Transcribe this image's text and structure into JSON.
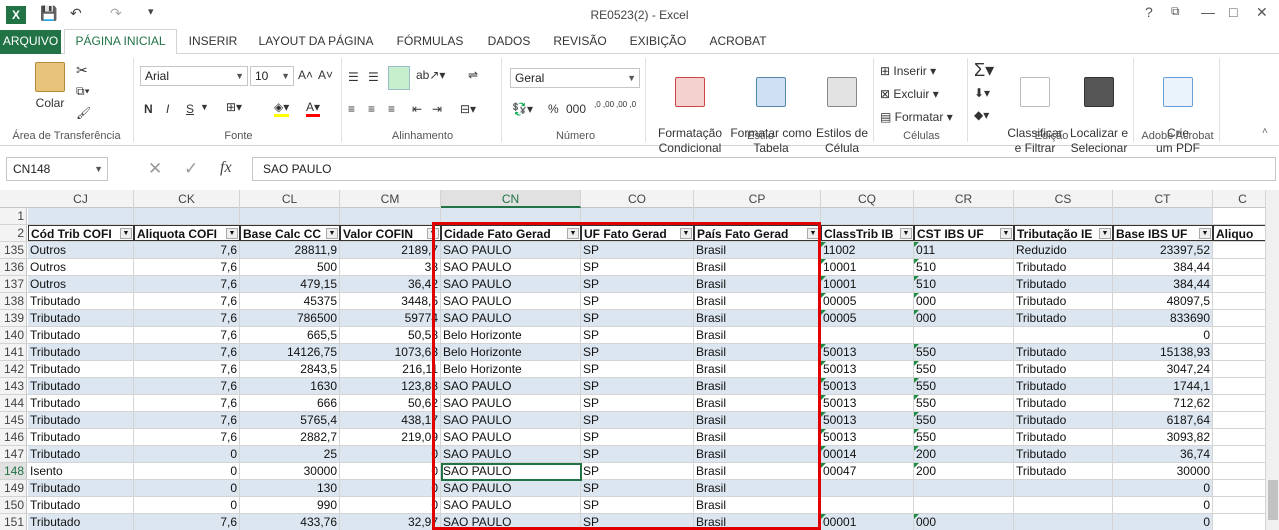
{
  "window": {
    "title": "RE0523(2) - Excel",
    "help": "?",
    "restore": "⧉",
    "min": "—",
    "max": "□",
    "close": "✕"
  },
  "quick_access": {
    "app_icon": "X",
    "save": "💾",
    "undo": "↶",
    "redo": "↷",
    "more": "▾"
  },
  "tabs": [
    "ARQUIVO",
    "PÁGINA INICIAL",
    "INSERIR",
    "LAYOUT DA PÁGINA",
    "FÓRMULAS",
    "DADOS",
    "REVISÃO",
    "EXIBIÇÃO",
    "ACROBAT"
  ],
  "active_tab": "PÁGINA INICIAL",
  "ribbon": {
    "clipboard": {
      "paste": "Colar",
      "label": "Área de Transferência"
    },
    "font": {
      "name": "Arial",
      "size": "10",
      "bold": "N",
      "italic": "I",
      "underline": "S",
      "grow": "A˄",
      "shrink": "A˅",
      "label": "Fonte"
    },
    "alignment": {
      "label": "Alinhamento"
    },
    "number": {
      "format": "Geral",
      "percent": "%",
      "thousands": "000",
      "dec_up": ",0 ,00",
      "dec_down": ",00 ,0",
      "label": "Número"
    },
    "styles": {
      "cond_format": "Formatação\nCondicional",
      "format_table": "Formatar como\nTabela",
      "cell_styles": "Estilos de\nCélula",
      "label": "Estilo"
    },
    "cells": {
      "insert": "Inserir",
      "delete": "Excluir",
      "format": "Formatar",
      "label": "Células"
    },
    "editing": {
      "sort": "Classificar\ne Filtrar",
      "find": "Localizar e\nSelecionar",
      "label": "Edição"
    },
    "acrobat": {
      "create_pdf": "Crie\num PDF",
      "label": "Adobe Acrobat"
    }
  },
  "formula_bar": {
    "name_box": "CN148",
    "cancel": "✕",
    "enter": "✓",
    "fx": "fx",
    "value": "SAO PAULO"
  },
  "columns": [
    "CJ",
    "CK",
    "CL",
    "CM",
    "CN",
    "CO",
    "CP",
    "CQ",
    "CR",
    "CS",
    "CT",
    "C"
  ],
  "selected_column": "CN",
  "header_row": [
    "Cód Trib COFI",
    "Aliquota COFI",
    "Base Calc CC",
    "Valor COFIN",
    "Cidade Fato Gerad",
    "UF Fato Gerad",
    "País Fato Gerad",
    "ClassTrib IB",
    "CST IBS UF",
    "Tributação IE",
    "Base IBS UF",
    "Aliquo"
  ],
  "rows": [
    {
      "n": "135",
      "cells": [
        "Outros",
        "7,6",
        "28811,9",
        "2189,7",
        "SAO PAULO",
        "SP",
        "Brasil",
        "11002",
        "011",
        "Reduzido",
        "23397,52"
      ]
    },
    {
      "n": "136",
      "cells": [
        "Outros",
        "7,6",
        "500",
        "38",
        "SAO PAULO",
        "SP",
        "Brasil",
        "10001",
        "510",
        "Tributado",
        "384,44"
      ]
    },
    {
      "n": "137",
      "cells": [
        "Outros",
        "7,6",
        "479,15",
        "36,42",
        "SAO PAULO",
        "SP",
        "Brasil",
        "10001",
        "510",
        "Tributado",
        "384,44"
      ]
    },
    {
      "n": "138",
      "cells": [
        "Tributado",
        "7,6",
        "45375",
        "3448,5",
        "SAO PAULO",
        "SP",
        "Brasil",
        "00005",
        "000",
        "Tributado",
        "48097,5"
      ]
    },
    {
      "n": "139",
      "cells": [
        "Tributado",
        "7,6",
        "786500",
        "59774",
        "SAO PAULO",
        "SP",
        "Brasil",
        "00005",
        "000",
        "Tributado",
        "833690"
      ]
    },
    {
      "n": "140",
      "cells": [
        "Tributado",
        "7,6",
        "665,5",
        "50,58",
        "Belo Horizonte",
        "SP",
        "Brasil",
        "",
        "",
        "",
        "0"
      ]
    },
    {
      "n": "141",
      "cells": [
        "Tributado",
        "7,6",
        "14126,75",
        "1073,63",
        "Belo Horizonte",
        "SP",
        "Brasil",
        "50013",
        "550",
        "Tributado",
        "15138,93"
      ]
    },
    {
      "n": "142",
      "cells": [
        "Tributado",
        "7,6",
        "2843,5",
        "216,11",
        "Belo Horizonte",
        "SP",
        "Brasil",
        "50013",
        "550",
        "Tributado",
        "3047,24"
      ]
    },
    {
      "n": "143",
      "cells": [
        "Tributado",
        "7,6",
        "1630",
        "123,88",
        "SAO PAULO",
        "SP",
        "Brasil",
        "50013",
        "550",
        "Tributado",
        "1744,1"
      ]
    },
    {
      "n": "144",
      "cells": [
        "Tributado",
        "7,6",
        "666",
        "50,62",
        "SAO PAULO",
        "SP",
        "Brasil",
        "50013",
        "550",
        "Tributado",
        "712,62"
      ]
    },
    {
      "n": "145",
      "cells": [
        "Tributado",
        "7,6",
        "5765,4",
        "438,17",
        "SAO PAULO",
        "SP",
        "Brasil",
        "50013",
        "550",
        "Tributado",
        "6187,64"
      ]
    },
    {
      "n": "146",
      "cells": [
        "Tributado",
        "7,6",
        "2882,7",
        "219,09",
        "SAO PAULO",
        "SP",
        "Brasil",
        "50013",
        "550",
        "Tributado",
        "3093,82"
      ]
    },
    {
      "n": "147",
      "cells": [
        "Tributado",
        "0",
        "25",
        "0",
        "SAO PAULO",
        "SP",
        "Brasil",
        "00014",
        "200",
        "Tributado",
        "36,74"
      ]
    },
    {
      "n": "148",
      "cells": [
        "Isento",
        "0",
        "30000",
        "0",
        "SAO PAULO",
        "SP",
        "Brasil",
        "00047",
        "200",
        "Tributado",
        "30000"
      ]
    },
    {
      "n": "149",
      "cells": [
        "Tributado",
        "0",
        "130",
        "0",
        "SAO PAULO",
        "SP",
        "Brasil",
        "",
        "",
        "",
        "0"
      ]
    },
    {
      "n": "150",
      "cells": [
        "Tributado",
        "0",
        "990",
        "0",
        "SAO PAULO",
        "SP",
        "Brasil",
        "",
        "",
        "",
        "0"
      ]
    },
    {
      "n": "151",
      "cells": [
        "Tributado",
        "7,6",
        "433,76",
        "32,97",
        "SAO PAULO",
        "SP",
        "Brasil",
        "00001",
        "000",
        "",
        "0"
      ]
    }
  ],
  "selected_row": "148",
  "row1_label": "1",
  "row2_label": "2"
}
